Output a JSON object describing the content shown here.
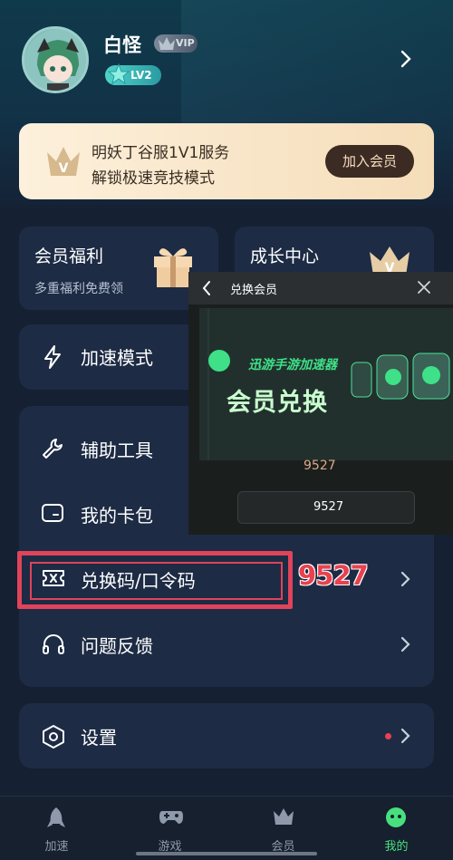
{
  "profile": {
    "username": "白怪",
    "vip_label": "VIP",
    "level_label": "LV2"
  },
  "banner": {
    "line1": "明妖丁谷服1V1服务",
    "line2": "解锁极速竞技模式",
    "join_button": "加入会员"
  },
  "cards": [
    {
      "title": "会员福利",
      "subtitle": "多重福利免费领"
    },
    {
      "title": "成长中心"
    }
  ],
  "menu": {
    "speed_mode": "加速模式",
    "tools": "辅助工具",
    "wallet": "我的卡包",
    "redeem": "兑换码/口令码",
    "feedback": "问题反馈",
    "settings": "设置"
  },
  "popup": {
    "title": "兑换会员",
    "brand": "迅游手游加速器",
    "heading": "会员兑换",
    "code_display": "9527",
    "input_value": "9527"
  },
  "annotation": {
    "code": "9527"
  },
  "bottom_nav": [
    {
      "label": "加速",
      "icon": "rocket-icon",
      "active": false
    },
    {
      "label": "游戏",
      "icon": "gamepad-icon",
      "active": false
    },
    {
      "label": "会员",
      "icon": "crown-icon",
      "active": false
    },
    {
      "label": "我的",
      "icon": "profile-face-icon",
      "active": true
    }
  ],
  "colors": {
    "accent": "#48e07e",
    "highlight": "#e0435a",
    "card": "#1d2b44",
    "background": "#152033"
  }
}
